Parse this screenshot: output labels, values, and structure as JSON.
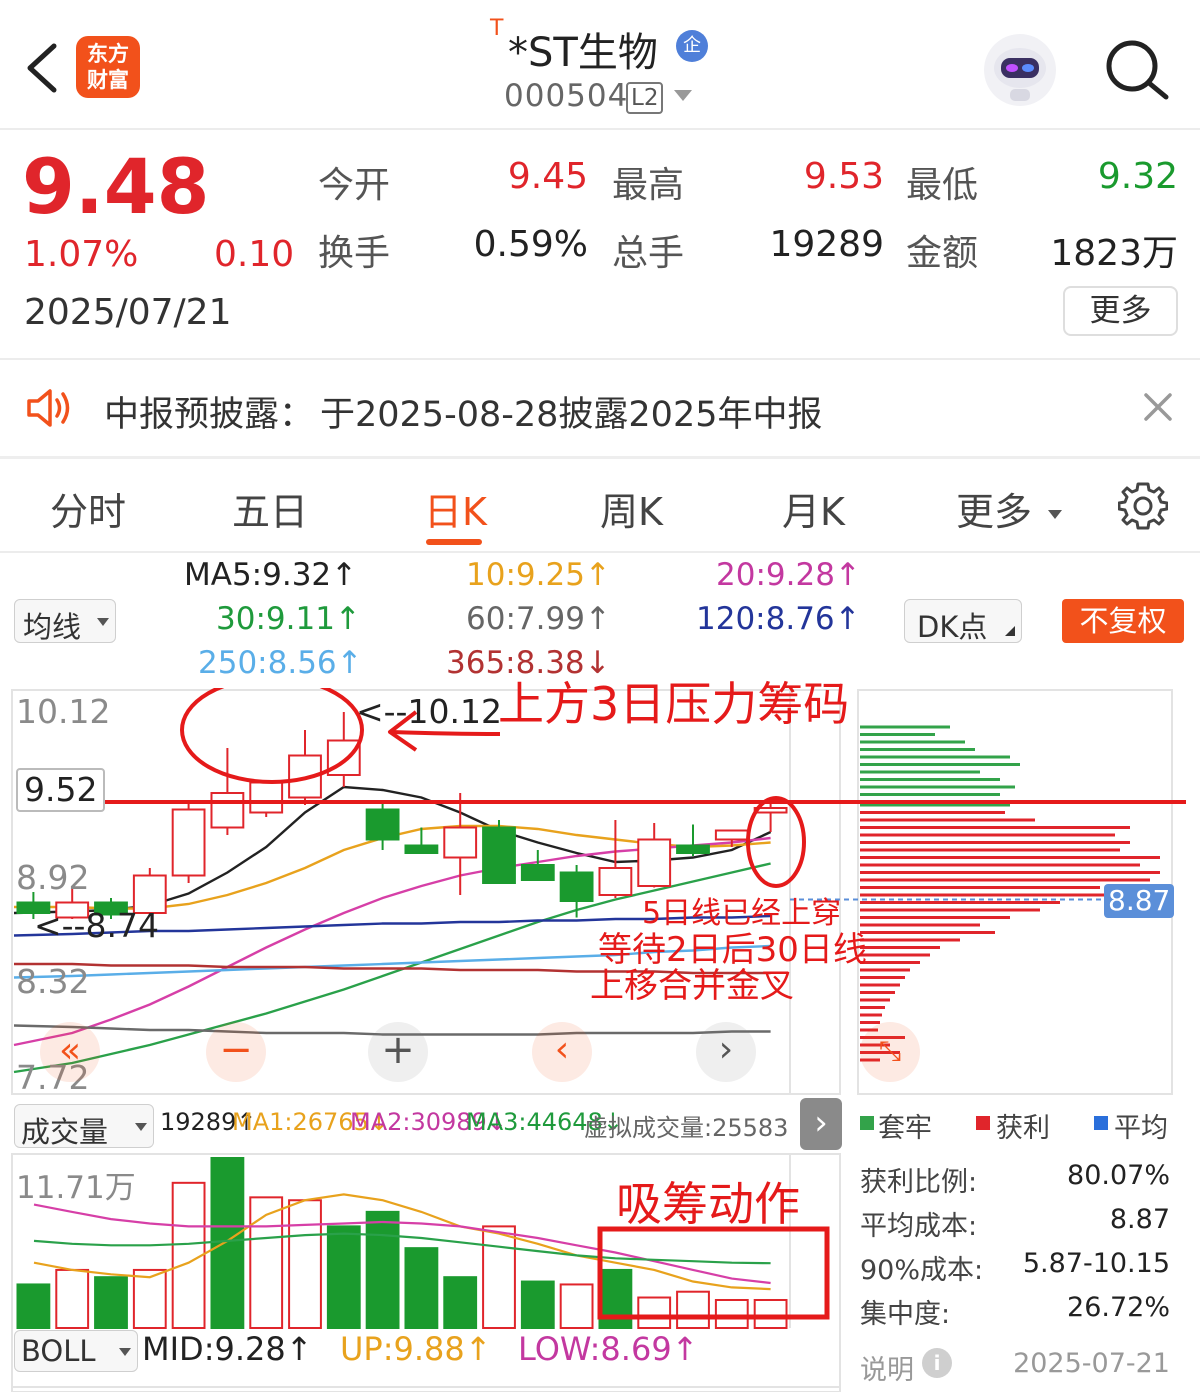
{
  "header": {
    "back_icon": "chevron-left-icon",
    "logo_text": "东方\n财富",
    "title_prefix": "T",
    "title": "*ST生物",
    "badge_icon": "企",
    "code": "000504",
    "level": "L2",
    "search_icon": "search-icon",
    "brand_color": "#f2511b"
  },
  "quote": {
    "price": "9.48",
    "change_pct": "1.07%",
    "change": "0.10",
    "date": "2025/07/21",
    "stats": [
      {
        "label": "今开",
        "value": "9.45",
        "color": "#e0252b"
      },
      {
        "label": "最高",
        "value": "9.53",
        "color": "#e0252b"
      },
      {
        "label": "最低",
        "value": "9.32",
        "color": "#1a9a2e"
      },
      {
        "label": "换手",
        "value": "0.59%",
        "color": "#222222"
      },
      {
        "label": "总手",
        "value": "19289",
        "color": "#222222"
      },
      {
        "label": "金额",
        "value": "1823万",
        "color": "#222222"
      }
    ],
    "more_label": "更多"
  },
  "notice": {
    "icon": "speaker-icon",
    "label": "中报预披露：",
    "text": "于2025-08-28披露2025年中报",
    "close_icon": "close-icon"
  },
  "tabs": {
    "items": [
      "分时",
      "五日",
      "日K",
      "周K",
      "月K",
      "更多"
    ],
    "active": "日K",
    "settings_icon": "gear-icon"
  },
  "ma_panel": {
    "selector": "均线",
    "ma5": "MA5:9.32↑",
    "ma10": "10:9.25↑",
    "ma20": "20:9.28↑",
    "ma30": "30:9.11↑",
    "ma60": "60:7.99↑",
    "ma120": "120:8.76↑",
    "ma250": "250:8.56↑",
    "ma365": "365:8.38↓",
    "dk_button": "DK点",
    "adjust_button": "不复权"
  },
  "price_axis": {
    "labels": [
      "10.12",
      "9.52",
      "8.92",
      "8.32",
      "7.72"
    ],
    "max_marker": "<--10.12",
    "min_marker": "<--8.74",
    "avg_cost_tag": "8.87"
  },
  "annotations": {
    "pressure": "上方3日压力筹码",
    "note_line1": "5日线已经上穿",
    "note_line2": "等待2日后30日线",
    "note_line3": "上移合并金叉",
    "volume_note": "吸筹动作"
  },
  "volume_panel": {
    "selector": "成交量",
    "vol": "19289↑",
    "ma1": "MA1:26765↓",
    "ma2": "MA2:30989↓",
    "ma3": "MA3:44648↓",
    "virtual": "虚拟成交量:25583",
    "max_label": "11.71万",
    "next_icon": "chevron-right-icon"
  },
  "boll_panel": {
    "selector": "BOLL",
    "mid": "MID:9.28↑",
    "up": "UP:9.88↑",
    "low": "LOW:8.69↑"
  },
  "chip_panel": {
    "legend": [
      "套牢",
      "获利",
      "平均"
    ],
    "legend_colors": [
      "#33a34a",
      "#e0252b",
      "#2a6fdb"
    ],
    "rows": [
      {
        "label": "获利比例:",
        "value": "80.07%"
      },
      {
        "label": "平均成本:",
        "value": "8.87"
      },
      {
        "label": "90%成本:",
        "value": "5.87-10.15"
      },
      {
        "label": "集中度:",
        "value": "26.72%"
      }
    ],
    "note_label": "说明",
    "note_date": "2025-07-21"
  },
  "chart_data": [
    {
      "type": "candlestick",
      "title": "",
      "ylim": [
        7.72,
        10.12
      ],
      "y_ticks": [
        10.12,
        9.52,
        8.92,
        8.32,
        7.72
      ],
      "candles": [
        {
          "o": 8.85,
          "h": 8.92,
          "l": 8.74,
          "c": 8.78
        },
        {
          "o": 8.75,
          "h": 8.95,
          "l": 8.74,
          "c": 8.85
        },
        {
          "o": 8.85,
          "h": 8.88,
          "l": 8.74,
          "c": 8.77
        },
        {
          "o": 8.78,
          "h": 9.08,
          "l": 8.76,
          "c": 9.03
        },
        {
          "o": 9.03,
          "h": 9.52,
          "l": 8.98,
          "c": 9.47
        },
        {
          "o": 9.35,
          "h": 9.88,
          "l": 9.3,
          "c": 9.58
        },
        {
          "o": 9.45,
          "h": 9.65,
          "l": 9.42,
          "c": 9.65
        },
        {
          "o": 9.55,
          "h": 10.0,
          "l": 9.5,
          "c": 9.83
        },
        {
          "o": 9.7,
          "h": 10.12,
          "l": 9.62,
          "c": 9.93
        },
        {
          "o": 9.47,
          "h": 9.52,
          "l": 9.2,
          "c": 9.27
        },
        {
          "o": 9.23,
          "h": 9.35,
          "l": 9.18,
          "c": 9.18
        },
        {
          "o": 9.15,
          "h": 9.58,
          "l": 8.9,
          "c": 9.35
        },
        {
          "o": 9.35,
          "h": 9.4,
          "l": 8.98,
          "c": 8.98
        },
        {
          "o": 9.1,
          "h": 9.2,
          "l": 9.0,
          "c": 9.0
        },
        {
          "o": 9.05,
          "h": 9.1,
          "l": 8.75,
          "c": 8.86
        },
        {
          "o": 8.9,
          "h": 9.4,
          "l": 8.88,
          "c": 9.08
        },
        {
          "o": 8.96,
          "h": 9.38,
          "l": 8.95,
          "c": 9.27
        },
        {
          "o": 9.23,
          "h": 9.37,
          "l": 9.16,
          "c": 9.18
        },
        {
          "o": 9.27,
          "h": 9.33,
          "l": 9.22,
          "c": 9.33
        },
        {
          "o": 9.45,
          "h": 9.53,
          "l": 9.32,
          "c": 9.48
        }
      ],
      "ma_lines": [
        {
          "name": "MA5",
          "color": "#222222",
          "values": [
            8.78,
            8.79,
            8.8,
            8.83,
            8.91,
            9.05,
            9.22,
            9.45,
            9.62,
            9.6,
            9.55,
            9.45,
            9.33,
            9.25,
            9.18,
            9.12,
            9.13,
            9.15,
            9.2,
            9.32
          ]
        },
        {
          "name": "MA10",
          "color": "#e8a21d",
          "values": [
            8.82,
            8.82,
            8.81,
            8.81,
            8.84,
            8.9,
            8.98,
            9.08,
            9.2,
            9.28,
            9.34,
            9.36,
            9.36,
            9.34,
            9.3,
            9.27,
            9.24,
            9.22,
            9.23,
            9.25
          ]
        },
        {
          "name": "MA20",
          "color": "#d63fa7",
          "values": [
            7.9,
            7.98,
            8.07,
            8.17,
            8.29,
            8.42,
            8.55,
            8.67,
            8.78,
            8.88,
            8.96,
            9.03,
            9.08,
            9.12,
            9.16,
            9.19,
            9.21,
            9.23,
            9.25,
            9.28
          ]
        },
        {
          "name": "MA30",
          "color": "#2aa14a",
          "values": [
            7.72,
            7.78,
            7.84,
            7.9,
            7.97,
            8.04,
            8.11,
            8.19,
            8.27,
            8.36,
            8.45,
            8.54,
            8.63,
            8.72,
            8.8,
            8.87,
            8.93,
            8.99,
            9.05,
            9.11
          ]
        },
        {
          "name": "MA60",
          "color": "#6a6a6a",
          "values": [
            8.03,
            8.02,
            8.01,
            8.0,
            8.0,
            7.99,
            7.98,
            7.98,
            7.98,
            7.97,
            7.97,
            7.97,
            7.97,
            7.97,
            7.98,
            7.98,
            7.98,
            7.98,
            7.99,
            7.99
          ]
        },
        {
          "name": "MA120",
          "color": "#23359a",
          "values": [
            8.63,
            8.64,
            8.65,
            8.66,
            8.66,
            8.67,
            8.68,
            8.69,
            8.7,
            8.71,
            8.71,
            8.72,
            8.72,
            8.73,
            8.73,
            8.74,
            8.74,
            8.75,
            8.75,
            8.76
          ]
        },
        {
          "name": "MA250",
          "color": "#5aaee8",
          "values": [
            8.35,
            8.36,
            8.37,
            8.38,
            8.39,
            8.4,
            8.41,
            8.42,
            8.43,
            8.44,
            8.45,
            8.46,
            8.47,
            8.48,
            8.49,
            8.5,
            8.52,
            8.53,
            8.55,
            8.56
          ]
        },
        {
          "name": "MA365",
          "color": "#b23232",
          "values": [
            8.44,
            8.44,
            8.43,
            8.43,
            8.43,
            8.42,
            8.42,
            8.42,
            8.41,
            8.41,
            8.41,
            8.4,
            8.4,
            8.4,
            8.39,
            8.39,
            8.39,
            8.38,
            8.38,
            8.38
          ]
        }
      ],
      "pressure_line": 9.52
    },
    {
      "type": "bar",
      "title": "",
      "ylim": [
        0,
        117100
      ],
      "values": [
        30000,
        40000,
        35000,
        40000,
        100000,
        117100,
        90000,
        88000,
        70000,
        80000,
        55000,
        35000,
        70000,
        32000,
        30000,
        40000,
        21000,
        25000,
        19289,
        19289
      ],
      "up": [
        false,
        true,
        false,
        true,
        true,
        false,
        true,
        true,
        false,
        false,
        false,
        false,
        true,
        false,
        true,
        false,
        true,
        true,
        true,
        true
      ],
      "ma_lines": [
        {
          "name": "MA1",
          "color": "#e8a21d",
          "values": [
            45000,
            40000,
            37000,
            35000,
            45000,
            60000,
            78000,
            88000,
            92000,
            88000,
            80000,
            70000,
            65000,
            58000,
            50000,
            45000,
            40000,
            32000,
            28000,
            26765
          ]
        },
        {
          "name": "MA2",
          "color": "#d63fa7",
          "values": [
            85000,
            80000,
            75000,
            72000,
            70000,
            70000,
            70000,
            71000,
            72000,
            73000,
            72000,
            70000,
            66000,
            62000,
            57000,
            52000,
            46000,
            40000,
            34000,
            30989
          ]
        },
        {
          "name": "MA3",
          "color": "#2aa14a",
          "values": [
            60000,
            58000,
            57000,
            57000,
            58000,
            60000,
            62000,
            64000,
            65000,
            64000,
            62000,
            59000,
            56000,
            53000,
            50000,
            48000,
            47000,
            46000,
            45000,
            44648
          ]
        }
      ]
    },
    {
      "type": "bar",
      "title": "",
      "orientation": "horizontal",
      "ylim": [
        7.72,
        10.12
      ],
      "prices": [
        10.02,
        9.97,
        9.92,
        9.87,
        9.82,
        9.77,
        9.72,
        9.67,
        9.62,
        9.57,
        9.5,
        9.45,
        9.4,
        9.35,
        9.3,
        9.25,
        9.2,
        9.15,
        9.1,
        9.05,
        9.0,
        8.95,
        8.9,
        8.85,
        8.8,
        8.75,
        8.7,
        8.65,
        8.6,
        8.55,
        8.5,
        8.45,
        8.4,
        8.35,
        8.3,
        8.25,
        8.2,
        8.15,
        8.1,
        8.05,
        8.0,
        7.95,
        7.9,
        7.85,
        7.8
      ],
      "volumes": [
        90,
        75,
        105,
        115,
        150,
        160,
        120,
        140,
        155,
        140,
        150,
        145,
        175,
        270,
        255,
        270,
        260,
        300,
        280,
        300,
        290,
        240,
        260,
        200,
        180,
        150,
        120,
        135,
        100,
        80,
        70,
        60,
        50,
        45,
        40,
        35,
        30,
        25,
        22,
        20,
        18,
        45,
        30,
        40,
        20
      ],
      "average_cost": 8.87
    }
  ]
}
